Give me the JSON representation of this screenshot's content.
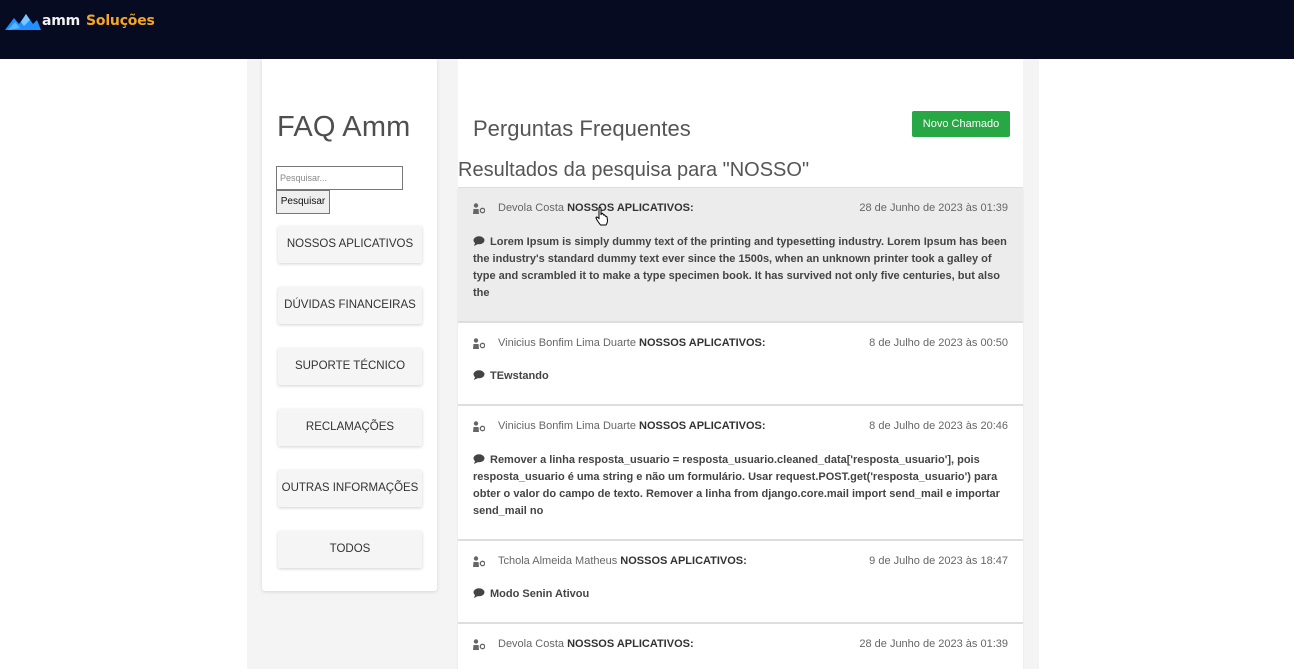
{
  "header": {
    "brand_part1": "amm",
    "brand_part2": "Soluções",
    "logo_icon": "amm-logo-icon"
  },
  "sidebar": {
    "title": "FAQ Amm",
    "search_placeholder": "Pesquisar...",
    "search_button": "Pesquisar",
    "categories": [
      "NOSSOS APLICATIVOS",
      "DÚVIDAS FINANCEIRAS",
      "SUPORTE TÉCNICO",
      "RECLAMAÇÕES",
      "OUTRAS INFORMAÇÕES",
      "TODOS"
    ]
  },
  "main": {
    "title": "Perguntas Frequentes",
    "new_button": "Novo Chamado",
    "results_title": "Resultados da pesquisa para \"NOSSO\"",
    "questions": [
      {
        "author": "Devola Costa",
        "category": "NOSSOS APLICATIVOS:",
        "date": "28 de Junho de 2023 às 01:39",
        "text": "Lorem Ipsum is simply dummy text of the printing and typesetting industry. Lorem Ipsum has been the industry's standard dummy text ever since the 1500s, when an unknown printer took a galley of type and scrambled it to make a type specimen book. It has survived not only five centuries, but also the"
      },
      {
        "author": "Vinicius Bonfim Lima Duarte",
        "category": "NOSSOS APLICATIVOS:",
        "date": "8 de Julho de 2023 às 00:50",
        "text": "TEwstando"
      },
      {
        "author": "Vinicius Bonfim Lima Duarte",
        "category": "NOSSOS APLICATIVOS:",
        "date": "8 de Julho de 2023 às 20:46",
        "text": "Remover a linha resposta_usuario = resposta_usuario.cleaned_data['resposta_usuario'], pois resposta_usuario é uma string e não um formulário. Usar request.POST.get('resposta_usuario') para obter o valor do campo de texto. Remover a linha from django.core.mail import send_mail e importar send_mail no"
      },
      {
        "author": "Tchola Almeida Matheus",
        "category": "NOSSOS APLICATIVOS:",
        "date": "9 de Julho de 2023 às 18:47",
        "text": "Modo Senin Ativou"
      },
      {
        "author": "Devola Costa",
        "category": "NOSSOS APLICATIVOS:",
        "date": "28 de Junho de 2023 às 01:39",
        "text": ""
      }
    ]
  },
  "colors": {
    "topbar": "#060b21",
    "brand_accent": "#f5a623",
    "new_button": "#28a745"
  }
}
